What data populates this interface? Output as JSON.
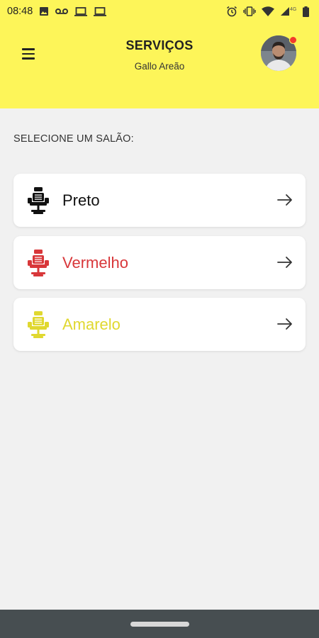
{
  "status_bar": {
    "time": "08:48",
    "network": "4G"
  },
  "header": {
    "title": "SERVIÇOS",
    "subtitle": "Gallo Areão"
  },
  "section": {
    "label": "SELECIONE UM SALÃO:"
  },
  "salons": [
    {
      "name": "Preto",
      "color": "#111111"
    },
    {
      "name": "Vermelho",
      "color": "#d8373a"
    },
    {
      "name": "Amarelo",
      "color": "#e0d830"
    }
  ],
  "colors": {
    "header_bg": "#fdf559",
    "page_bg": "#f1f1f1",
    "nav_bar": "#474e51",
    "notification_dot": "#f23a2c"
  }
}
